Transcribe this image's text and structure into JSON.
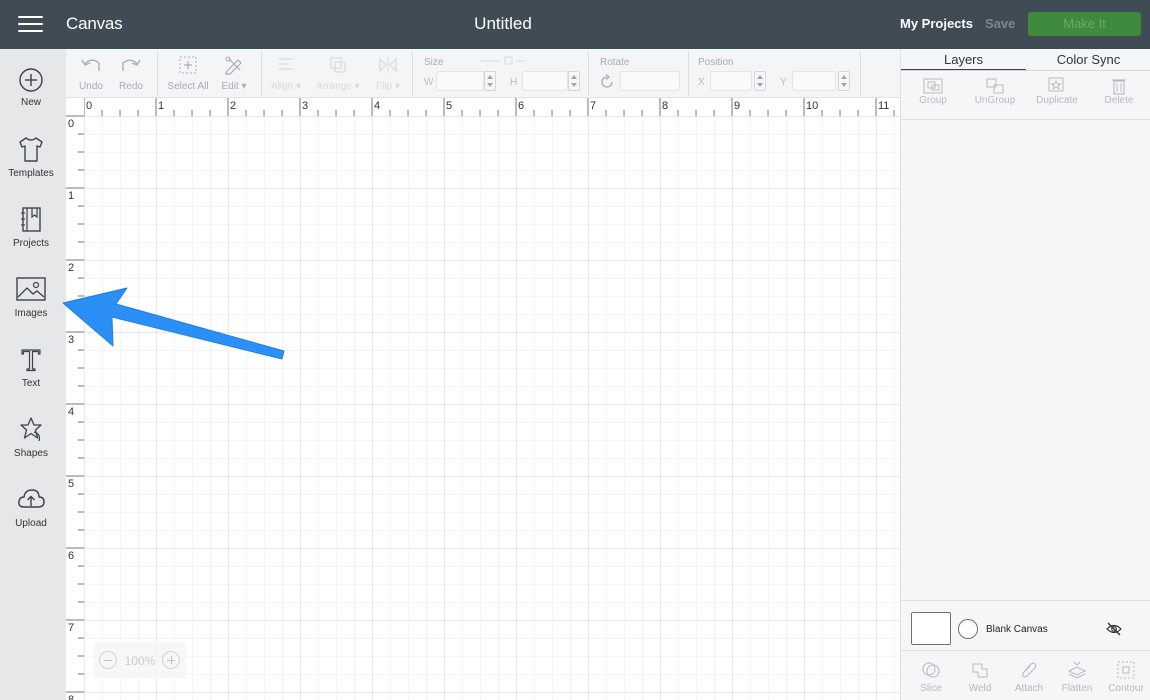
{
  "topbar": {
    "app_title": "Canvas",
    "doc_title": "Untitled",
    "my_projects": "My Projects",
    "save": "Save",
    "make_it": "Make It"
  },
  "sidebar": {
    "items": [
      {
        "label": "New",
        "icon": "plus-circle-icon"
      },
      {
        "label": "Templates",
        "icon": "tshirt-icon"
      },
      {
        "label": "Projects",
        "icon": "notebook-icon"
      },
      {
        "label": "Images",
        "icon": "image-icon"
      },
      {
        "label": "Text",
        "icon": "text-icon"
      },
      {
        "label": "Shapes",
        "icon": "shapes-icon"
      },
      {
        "label": "Upload",
        "icon": "upload-cloud-icon"
      }
    ]
  },
  "toolbar": {
    "undo": "Undo",
    "redo": "Redo",
    "select_all": "Select All",
    "edit": "Edit",
    "align": "Align",
    "arrange": "Arrange",
    "flip": "Flip",
    "size_label": "Size",
    "w": "W",
    "h": "H",
    "rotate_label": "Rotate",
    "position_label": "Position",
    "x": "X",
    "y": "Y"
  },
  "canvas": {
    "ruler_top": [
      "0",
      "1",
      "2",
      "3",
      "4",
      "5",
      "6",
      "7",
      "8",
      "9",
      "10",
      "11"
    ],
    "ruler_left": [
      "0",
      "1",
      "2",
      "3",
      "4",
      "5",
      "6",
      "7",
      "8"
    ],
    "zoom": "100%"
  },
  "right_panel": {
    "tabs": [
      "Layers",
      "Color Sync"
    ],
    "actions": [
      "Group",
      "UnGroup",
      "Duplicate",
      "Delete"
    ],
    "blank_canvas": "Blank Canvas",
    "bottom_tools": [
      "Slice",
      "Weld",
      "Attach",
      "Flatten",
      "Contour"
    ]
  },
  "colors": {
    "topbar": "#3f4c55",
    "make_it": "#3f8a3c",
    "arrow": "#2b8ff5",
    "sidebar": "#e6e7e9"
  }
}
